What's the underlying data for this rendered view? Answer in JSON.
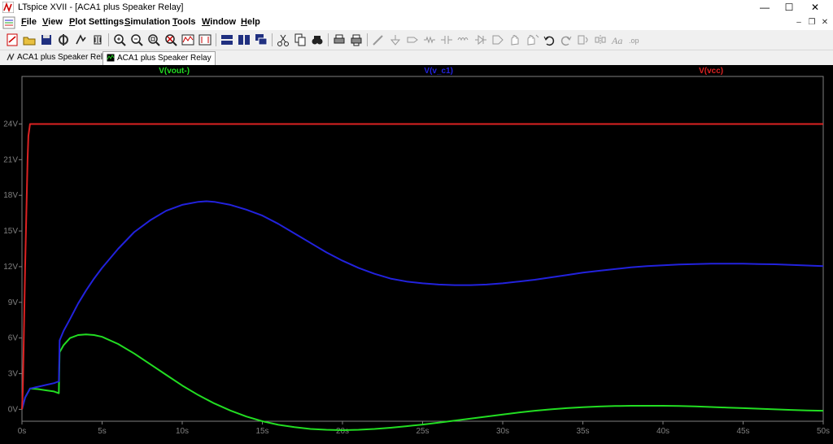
{
  "window": {
    "title": "LTspice XVII - [ACA1 plus Speaker Relay]",
    "controls": {
      "minimize": "—",
      "maximize": "☐",
      "close": "✕"
    },
    "mdi_controls": {
      "minimize": "–",
      "restore": "❐",
      "close": "✕"
    }
  },
  "menu": [
    {
      "key": "F",
      "rest": "ile"
    },
    {
      "key": "V",
      "rest": "iew"
    },
    {
      "key": "P",
      "rest": "lot Settings"
    },
    {
      "key": "S",
      "rest": "imulation"
    },
    {
      "key": "T",
      "rest": "ools"
    },
    {
      "key": "W",
      "rest": "indow"
    },
    {
      "key": "H",
      "rest": "elp"
    }
  ],
  "toolbar": [
    "new-schematic-icon",
    "open-icon",
    "save-icon",
    "control-panel-icon",
    "run-icon",
    "halt-icon",
    "zoom-in-icon",
    "zoom-out-icon",
    "zoom-fit-icon",
    "zoom-cancel-icon",
    "autorange-icon",
    "cursor-icon",
    "tile-horizontal-icon",
    "tile-vertical-icon",
    "cascade-icon",
    "cut-icon",
    "copy-icon",
    "find-icon",
    "print-icon",
    "print-setup-icon",
    "wire-icon",
    "ground-icon",
    "label-icon",
    "resistor-icon",
    "capacitor-icon",
    "inductor-icon",
    "diode-icon",
    "component-icon",
    "move-icon",
    "drag-icon",
    "undo-icon",
    "redo-icon",
    "rotate-icon",
    "mirror-icon",
    "text-icon",
    "spice-directive-icon"
  ],
  "tabs": [
    {
      "label": "ACA1 plus Speaker Relay",
      "active": false
    },
    {
      "label": "ACA1 plus Speaker Relay",
      "active": true
    }
  ],
  "chart_data": {
    "type": "line",
    "title": "",
    "xlabel": "",
    "ylabel": "",
    "xlim": [
      0,
      50
    ],
    "ylim": [
      -1,
      28
    ],
    "x_ticks": [
      "0s",
      "5s",
      "10s",
      "15s",
      "20s",
      "25s",
      "30s",
      "35s",
      "40s",
      "45s",
      "50s"
    ],
    "x_tick_values": [
      0,
      5,
      10,
      15,
      20,
      25,
      30,
      35,
      40,
      45,
      50
    ],
    "y_ticks": [
      "0V",
      "3V",
      "6V",
      "9V",
      "12V",
      "15V",
      "18V",
      "21V",
      "24V"
    ],
    "y_tick_values": [
      0,
      3,
      6,
      9,
      12,
      15,
      18,
      21,
      24
    ],
    "grid": false,
    "legend": "top",
    "series": [
      {
        "name": "V(vout-)",
        "color": "#22dd22",
        "x": [
          0,
          0.2,
          0.5,
          1,
          1.5,
          2,
          2.3,
          2.35,
          2.6,
          3,
          3.5,
          4,
          4.5,
          5,
          6,
          7,
          8,
          9,
          10,
          11,
          12,
          13,
          14,
          15,
          16,
          17,
          18,
          19,
          20,
          21,
          22,
          23,
          24,
          25,
          26,
          27,
          28,
          29,
          30,
          31,
          32,
          33,
          34,
          35,
          36,
          37,
          38,
          39,
          40,
          41,
          42,
          43,
          44,
          45,
          46,
          47,
          48,
          49,
          50
        ],
        "y": [
          0,
          1.0,
          1.75,
          1.7,
          1.6,
          1.5,
          1.35,
          4.8,
          5.4,
          6.0,
          6.25,
          6.3,
          6.25,
          6.1,
          5.5,
          4.7,
          3.8,
          2.9,
          2.0,
          1.2,
          0.5,
          -0.1,
          -0.6,
          -1.0,
          -1.3,
          -1.5,
          -1.65,
          -1.72,
          -1.75,
          -1.72,
          -1.65,
          -1.55,
          -1.42,
          -1.28,
          -1.12,
          -0.95,
          -0.78,
          -0.6,
          -0.43,
          -0.27,
          -0.12,
          0.0,
          0.1,
          0.18,
          0.24,
          0.28,
          0.3,
          0.3,
          0.3,
          0.28,
          0.25,
          0.2,
          0.15,
          0.1,
          0.05,
          0.0,
          -0.05,
          -0.1,
          -0.12
        ]
      },
      {
        "name": "V(v_c1)",
        "color": "#2222dd",
        "x": [
          0,
          0.2,
          0.5,
          1,
          1.5,
          2,
          2.3,
          2.35,
          2.6,
          3,
          3.5,
          4,
          4.5,
          5,
          6,
          7,
          8,
          9,
          10,
          11,
          11.5,
          12,
          13,
          14,
          15,
          16,
          17,
          18,
          19,
          20,
          21,
          22,
          23,
          24,
          25,
          26,
          27,
          28,
          29,
          30,
          31,
          32,
          33,
          34,
          35,
          36,
          37,
          38,
          39,
          40,
          41,
          42,
          43,
          44,
          45,
          46,
          47,
          48,
          49,
          50
        ],
        "y": [
          0,
          1.0,
          1.75,
          1.9,
          2.05,
          2.2,
          2.35,
          5.8,
          6.6,
          7.6,
          8.9,
          10.0,
          11.0,
          11.9,
          13.5,
          14.9,
          15.9,
          16.7,
          17.2,
          17.45,
          17.5,
          17.45,
          17.2,
          16.8,
          16.3,
          15.6,
          14.8,
          14.0,
          13.2,
          12.5,
          11.9,
          11.4,
          11.0,
          10.75,
          10.6,
          10.5,
          10.45,
          10.45,
          10.5,
          10.6,
          10.75,
          10.9,
          11.1,
          11.3,
          11.5,
          11.65,
          11.8,
          11.95,
          12.05,
          12.12,
          12.18,
          12.22,
          12.25,
          12.25,
          12.25,
          12.22,
          12.2,
          12.15,
          12.1,
          12.05
        ]
      },
      {
        "name": "V(vcc)",
        "color": "#dd2222",
        "x": [
          0,
          0.05,
          0.1,
          0.2,
          0.3,
          0.35,
          0.4,
          0.5,
          1,
          5,
          10,
          20,
          30,
          40,
          50
        ],
        "y": [
          0,
          1.5,
          5,
          12,
          18,
          21,
          23,
          24,
          24,
          24,
          24,
          24,
          24,
          24,
          24
        ]
      }
    ]
  }
}
